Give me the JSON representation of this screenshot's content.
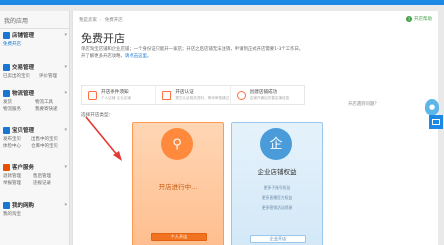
{
  "sidebar": {
    "title": "我的应用",
    "groups": [
      {
        "label": "店铺管理",
        "icon": "store-icon",
        "items": [
          "免费开店"
        ]
      },
      {
        "label": "交易管理",
        "icon": "trade-icon",
        "items": [
          "已卖出的宝贝",
          "评价管理"
        ]
      },
      {
        "label": "物流管理",
        "icon": "logistics-icon",
        "items": [
          "发货",
          "物流工具",
          "物流服务",
          "我要寄快递"
        ]
      },
      {
        "label": "宝贝管理",
        "icon": "product-icon",
        "items": [
          "发布宝贝",
          "出售中的宝贝",
          "体检中心",
          "仓库中的宝贝"
        ]
      },
      {
        "label": "客户服务",
        "icon": "service-icon",
        "items": [
          "退款管理",
          "售后管理",
          "举报管理",
          "违规记录"
        ]
      },
      {
        "label": "我的网购",
        "icon": "shopping-icon",
        "items": [
          "我的淘宝"
        ]
      }
    ]
  },
  "header": {
    "breadcrumb": [
      "我是卖家",
      "免费开店"
    ],
    "help_label": "开店帮助"
  },
  "main": {
    "title": "免费开店",
    "desc_line1": "单店淘宝店铺和企业店铺；一个身份证只能开一家店；开店之后店铺无法注销，申请到正式开店需要1-3个工作日。",
    "desc_line2_prefix": "开了解更多开店攻略，",
    "desc_line2_link": "请点击这里。",
    "steps": [
      {
        "icon": "rules-icon",
        "title": "开店条件须知",
        "sub": "个人店铺  企业店铺"
      },
      {
        "icon": "auth-icon",
        "title": "开店认证",
        "sub": "提交认证相关资料，等待审核通过"
      },
      {
        "icon": "success-icon",
        "title": "创建店铺成功",
        "sub": "店铺开通后完善店铺信息"
      }
    ],
    "choose_label": "选择开店类型：",
    "corner_text": "开店遇到问题？"
  },
  "cards": {
    "individual": {
      "icon": "person-icon",
      "status": "开店进行中...",
      "button": "个人开店"
    },
    "enterprise": {
      "icon": "enterprise-icon",
      "title": "企业店铺权益",
      "lines": [
        "更多子账号权益",
        "更多直播官方权益",
        "更多营销活动资源"
      ],
      "button": "企业开店"
    }
  },
  "colors": {
    "accent_blue": "#1e88e5",
    "card_orange": "#ff8a3d",
    "guide_red": "#e53935"
  }
}
